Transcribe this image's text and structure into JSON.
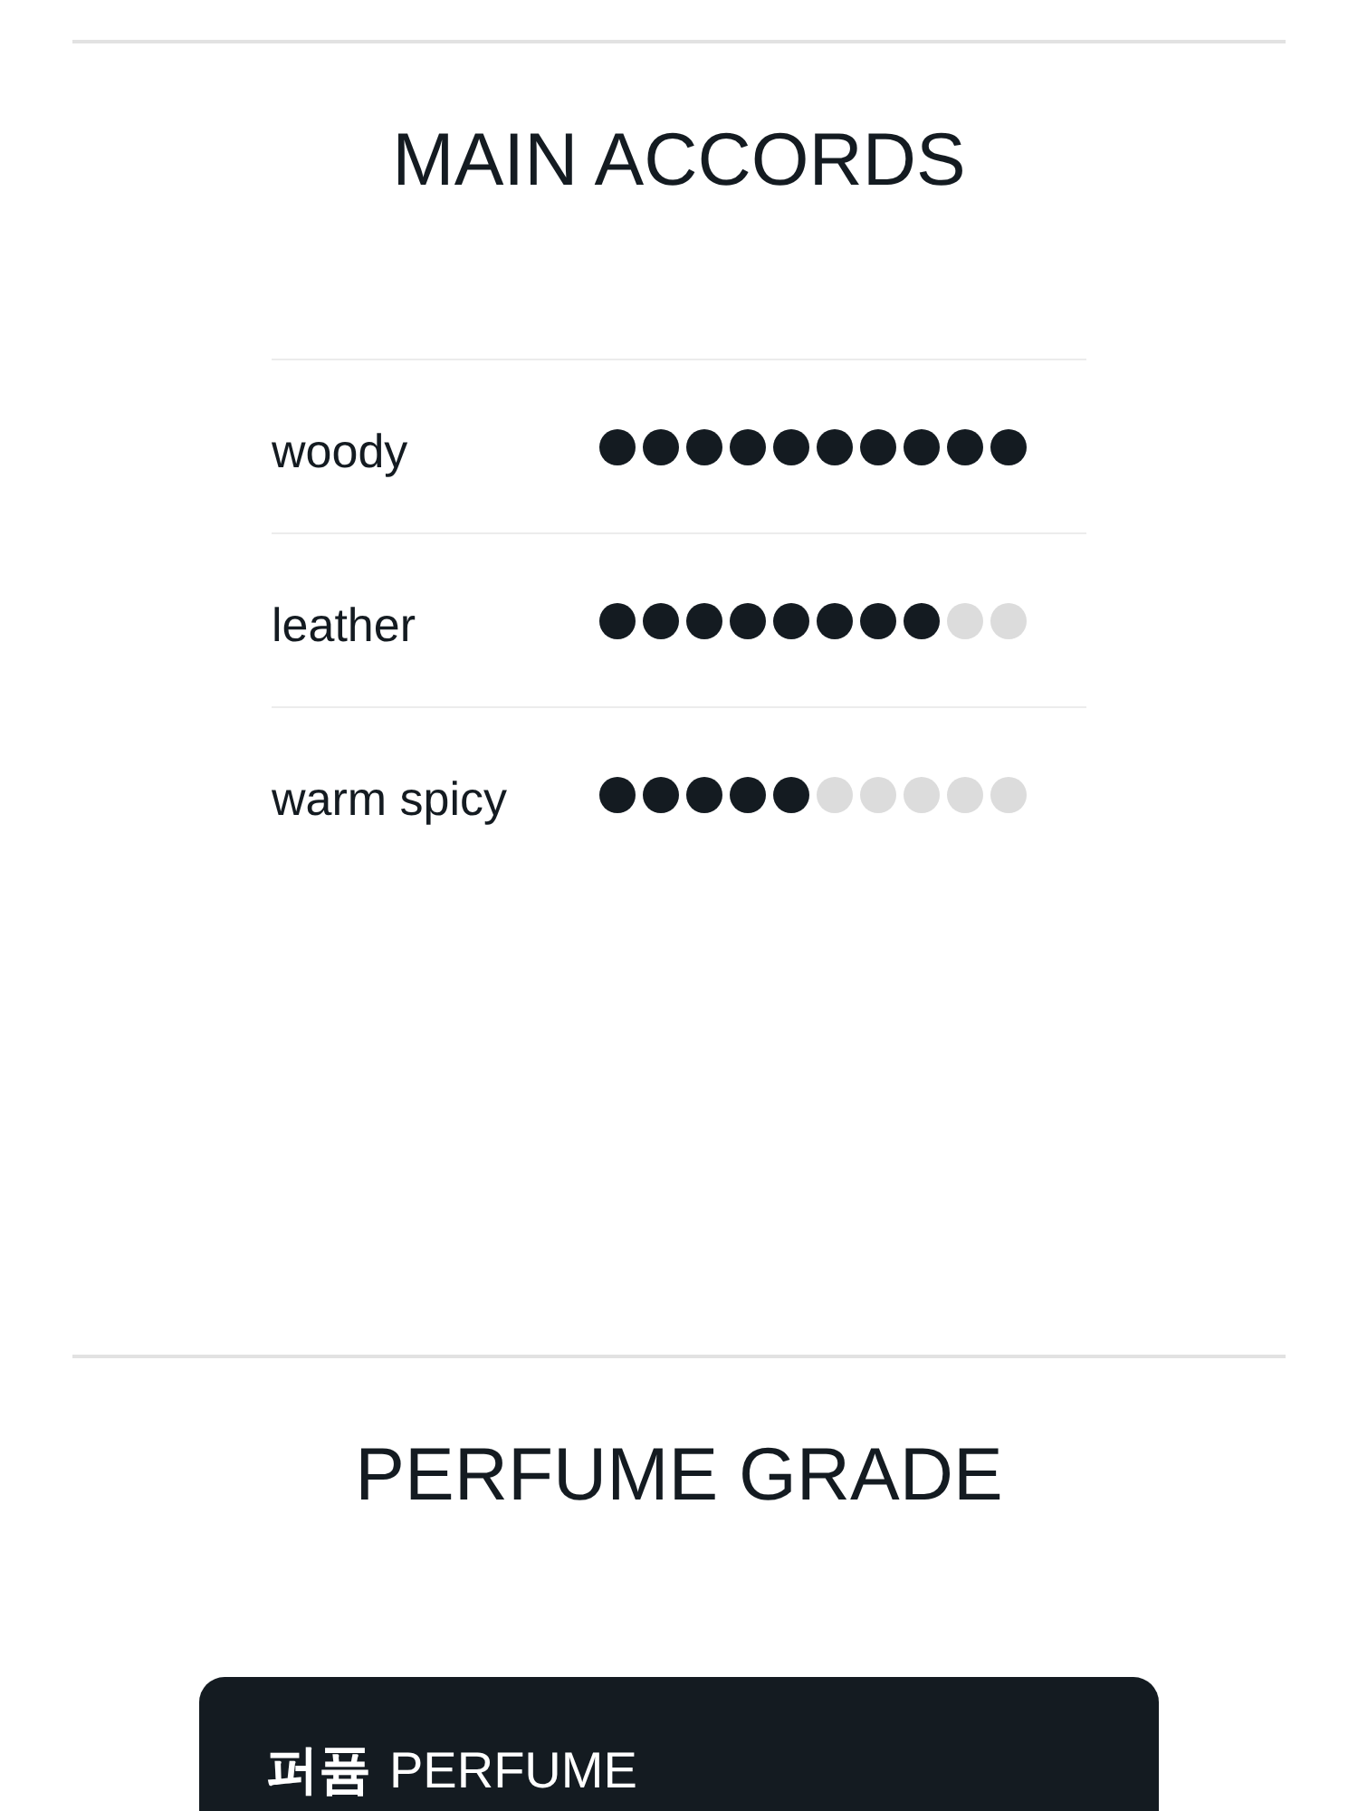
{
  "main_accords": {
    "title": "MAIN ACCORDS",
    "accords": [
      {
        "name": "woody",
        "stars": 10
      },
      {
        "name": "leather",
        "stars": 8
      },
      {
        "name": "warm spicy",
        "stars": 5
      }
    ]
  },
  "perfume_grade": {
    "title": "PERFUME GRADE",
    "card": {
      "korean": "퍼퓸",
      "label": "PERFUME"
    }
  }
}
